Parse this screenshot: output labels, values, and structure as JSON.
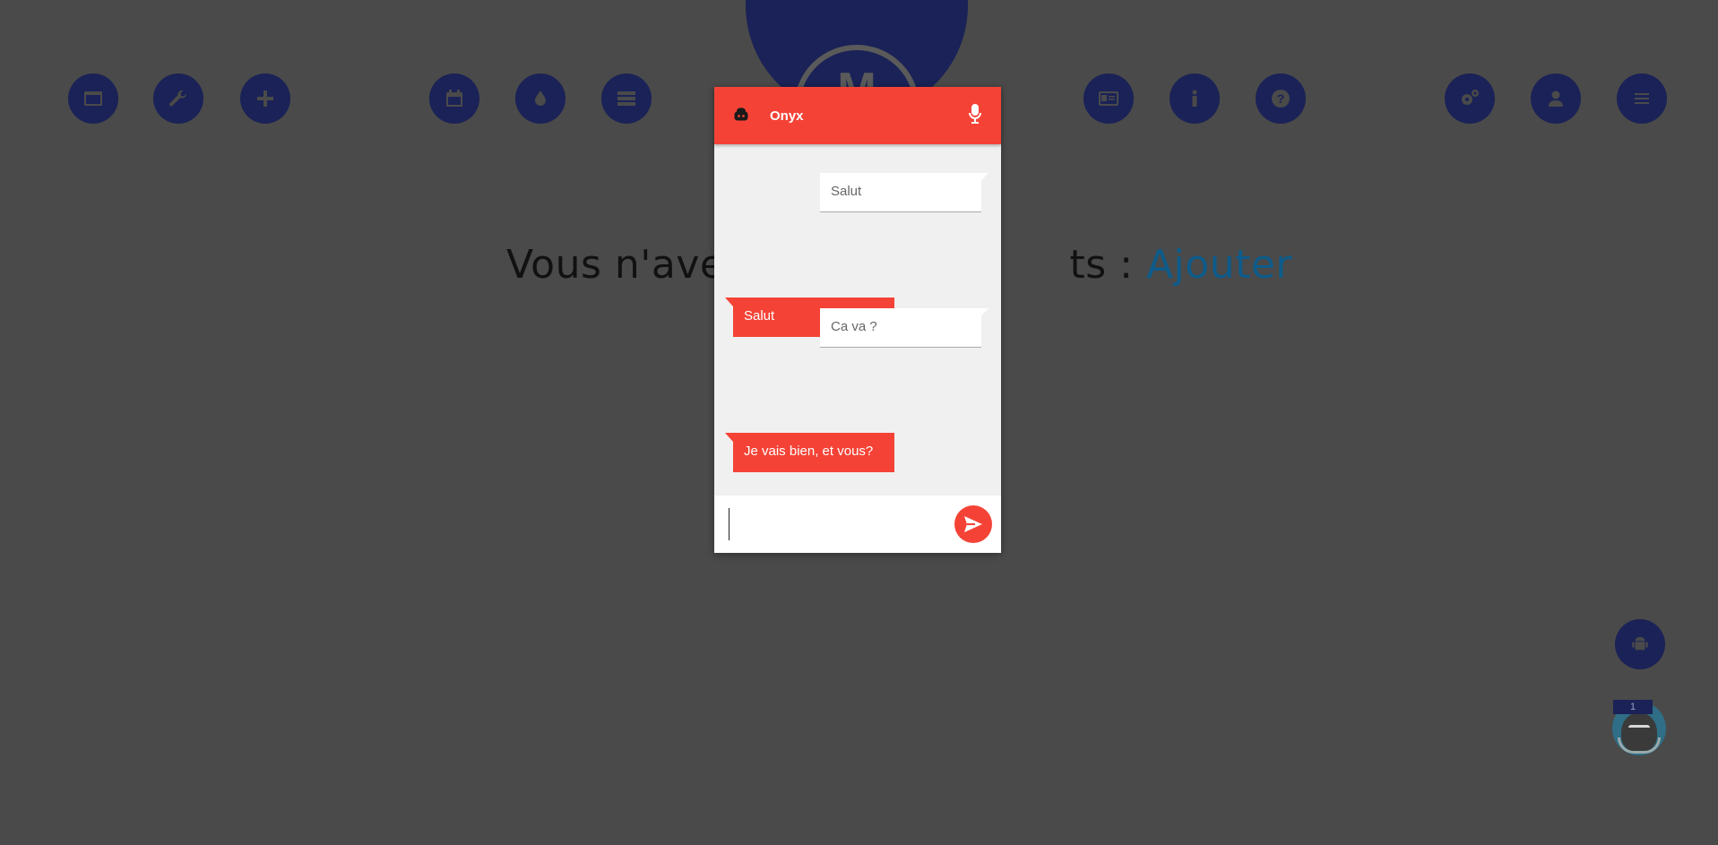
{
  "nav": {
    "items": [
      {
        "icon": "window-icon",
        "label": "window"
      },
      {
        "icon": "wrench-icon",
        "label": "tools"
      },
      {
        "icon": "plus-icon",
        "label": "add"
      },
      {
        "icon": "calendar-icon",
        "label": "calendar"
      },
      {
        "icon": "drop-icon",
        "label": "drop"
      },
      {
        "icon": "list-icon",
        "label": "list"
      },
      {
        "icon": "id-card-icon",
        "label": "contact card"
      },
      {
        "icon": "info-icon",
        "label": "info"
      },
      {
        "icon": "help-icon",
        "label": "help"
      },
      {
        "icon": "gears-icon",
        "label": "settings"
      },
      {
        "icon": "user-icon",
        "label": "user"
      },
      {
        "icon": "menu-icon",
        "label": "menu"
      }
    ]
  },
  "headline": {
    "text_before": "Vous n'ave",
    "text_after": "ts : ",
    "link": "Ajouter"
  },
  "chat": {
    "title": "Onyx",
    "messages": [
      {
        "from": "user",
        "text": "Salut"
      },
      {
        "from": "bot",
        "text": "Salut"
      },
      {
        "from": "user",
        "text": "Ca va ?"
      },
      {
        "from": "bot",
        "text": "Je vais bien, et vous?"
      }
    ],
    "input_value": ""
  },
  "notification_badge": "1",
  "colors": {
    "background": "#4a4a4a",
    "navy": "#1a2257",
    "chat_red": "#f44336",
    "link_blue": "#0d5b8a"
  }
}
